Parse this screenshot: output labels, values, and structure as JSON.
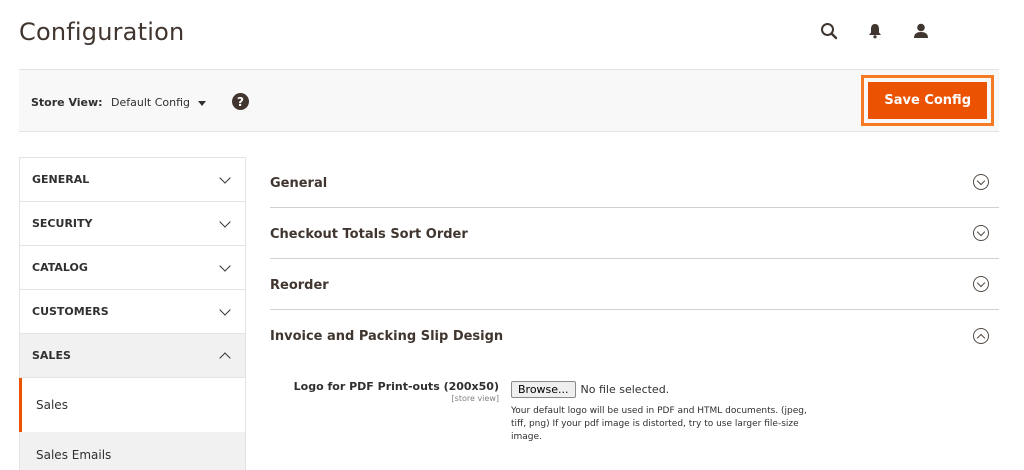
{
  "header": {
    "title": "Configuration",
    "icons": [
      "search-icon",
      "bell-icon",
      "user-icon"
    ]
  },
  "store_bar": {
    "label": "Store View:",
    "current_scope": "Default Config",
    "help_glyph": "?",
    "save_label": "Save Config"
  },
  "sidebar": {
    "tabs": [
      {
        "label": "GENERAL",
        "expanded": false
      },
      {
        "label": "SECURITY",
        "expanded": false
      },
      {
        "label": "CATALOG",
        "expanded": false
      },
      {
        "label": "CUSTOMERS",
        "expanded": false
      },
      {
        "label": "SALES",
        "expanded": true
      }
    ],
    "sales_items": [
      {
        "label": "Sales",
        "active": true
      },
      {
        "label": "Sales Emails",
        "active": false
      }
    ]
  },
  "main": {
    "sections": [
      {
        "title": "General",
        "expanded": false
      },
      {
        "title": "Checkout Totals Sort Order",
        "expanded": false
      },
      {
        "title": "Reorder",
        "expanded": false
      },
      {
        "title": "Invoice and Packing Slip Design",
        "expanded": true
      }
    ],
    "field": {
      "label": "Logo for PDF Print-outs (200x50)",
      "scope": "[store view]",
      "browse_label": "Browse...",
      "file_status": "No file selected.",
      "note": "Your default logo will be used in PDF and HTML documents. (jpeg, tiff, png) If your pdf image is distorted, try to use larger file-size image."
    }
  },
  "colors": {
    "accent": "#eb5202",
    "highlight_border": "#f47b24",
    "title": "#41362f"
  }
}
